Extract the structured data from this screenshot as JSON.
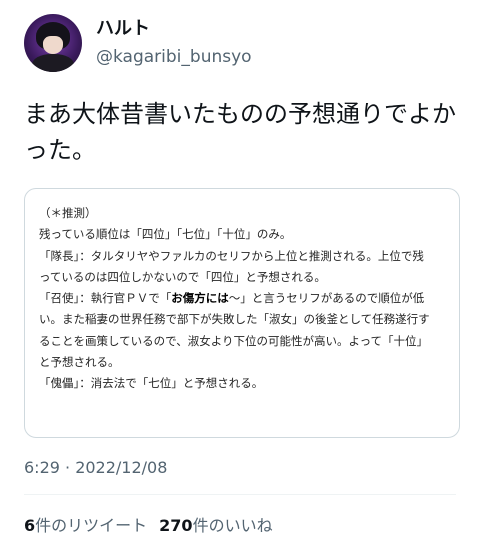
{
  "user": {
    "display_name": "ハルト",
    "handle": "@kagaribi_bunsyo"
  },
  "tweet": {
    "text": "まあ大体昔書いたものの予想通りでよかった。",
    "timestamp": "6:29 · 2022/12/08"
  },
  "memo": {
    "line1": "（＊推測）",
    "line2": "残っている順位は「四位」「七位」「十位」のみ。",
    "line3": "「隊長」：タルタリヤやファルカのセリフから上位と推測される。上位で残",
    "line4": "っているのは四位しかないので「四位」と予想される。",
    "line5_pre": "「召使」：執行官ＰＶで「",
    "line5_bold": "お傷方には",
    "line5_post": "〜」と言うセリフがあるので順位が低",
    "line6": "い。また稲妻の世界任務で部下が失敗した「淑女」の後釜として任務遂行す",
    "line7": "ることを画策しているので、淑女より下位の可能性が高い。よって「十位」",
    "line8": "と予想される。",
    "line9": "「傀儡」：消去法で「七位」と予想される。"
  },
  "stats": {
    "retweet_count": "6",
    "retweet_label": "件のリツイート",
    "like_count": "270",
    "like_label": "件のいいね"
  }
}
